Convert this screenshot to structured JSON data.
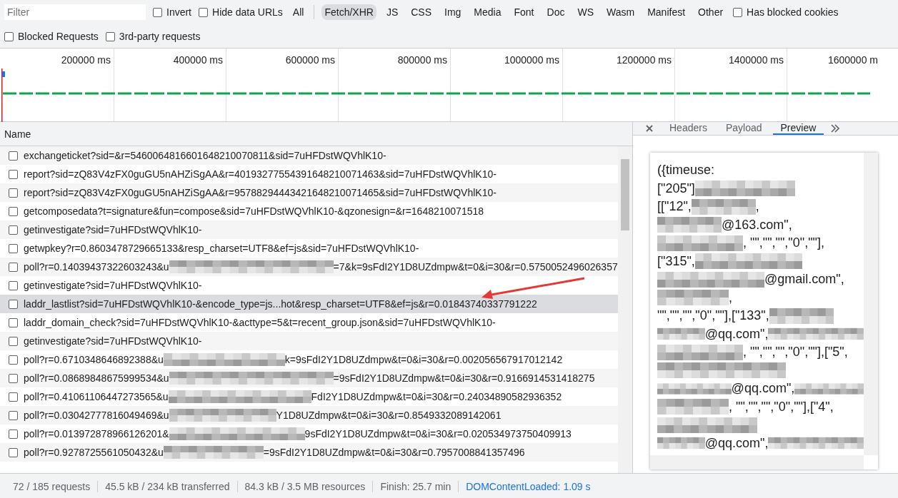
{
  "filter_bar": {
    "placeholder": "Filter",
    "checks_row1": [
      {
        "label": "Invert",
        "checked": false
      },
      {
        "label": "Hide data URLs",
        "checked": false
      }
    ],
    "types": [
      {
        "label": "All",
        "selected": false
      },
      {
        "label": "Fetch/XHR",
        "selected": true
      },
      {
        "label": "JS",
        "selected": false
      },
      {
        "label": "CSS",
        "selected": false
      },
      {
        "label": "Img",
        "selected": false
      },
      {
        "label": "Media",
        "selected": false
      },
      {
        "label": "Font",
        "selected": false
      },
      {
        "label": "Doc",
        "selected": false
      },
      {
        "label": "WS",
        "selected": false
      },
      {
        "label": "Wasm",
        "selected": false
      },
      {
        "label": "Manifest",
        "selected": false
      },
      {
        "label": "Other",
        "selected": false
      }
    ],
    "checks_row1_end": [
      {
        "label": "Has blocked cookies",
        "checked": false
      }
    ],
    "checks_row2": [
      {
        "label": "Blocked Requests",
        "checked": false
      },
      {
        "label": "3rd-party requests",
        "checked": false
      }
    ]
  },
  "timeline": {
    "ticks": [
      "200000 ms",
      "400000 ms",
      "600000 ms",
      "800000 ms",
      "1000000 ms",
      "1200000 ms",
      "1400000 ms",
      "1600000 m"
    ]
  },
  "requests": {
    "column": "Name",
    "rows": [
      {
        "selected": false,
        "parts": [
          {
            "kind": "text",
            "text": "exchangeticket?sid=&r=5460064816601648210070811&sid=7uHFDstWQVhlK10-"
          }
        ]
      },
      {
        "selected": false,
        "parts": [
          {
            "kind": "text",
            "text": "report?sid=zQ83V4zFX0guGU5nAHZiSgAA&r=40193277554391648210071463&sid=7uHFDstWQVhlK10-"
          }
        ]
      },
      {
        "selected": false,
        "parts": [
          {
            "kind": "text",
            "text": "report?sid=zQ83V4zFX0guGU5nAHZiSgAA&r=95788294443421648210071465&sid=7uHFDstWQVhlK10-"
          }
        ]
      },
      {
        "selected": false,
        "parts": [
          {
            "kind": "text",
            "text": "getcomposedata?t=signature&fun=compose&sid=7uHFDstWQVhlK10-&qzonesign=&r=1648210071518"
          }
        ]
      },
      {
        "selected": false,
        "parts": [
          {
            "kind": "text",
            "text": "getinvestigate?sid=7uHFDstWQVhlK10-"
          }
        ]
      },
      {
        "selected": false,
        "parts": [
          {
            "kind": "text",
            "text": "getwpkey?r=0.8603478729665133&resp_charset=UTF8&ef=js&sid=7uHFDstWQVhlK10-"
          }
        ]
      },
      {
        "selected": false,
        "parts": [
          {
            "kind": "text",
            "text": "poll?r=0.14039437322603243&u"
          },
          {
            "kind": "blur"
          },
          {
            "kind": "text",
            "text": "=7&k=9sFdI2Y1D8UZdmpw&t=0&i=30&r=0.5750052496026357"
          }
        ]
      },
      {
        "selected": false,
        "parts": [
          {
            "kind": "text",
            "text": "getinvestigate?sid=7uHFDstWQVhlK10-"
          }
        ]
      },
      {
        "selected": true,
        "parts": [
          {
            "kind": "text",
            "text": "laddr_lastlist?sid=7uHFDstWQVhlK10-&encode_type=js...hot&resp_charset=UTF8&ef=js&r=0.01843740337791222"
          }
        ]
      },
      {
        "selected": false,
        "parts": [
          {
            "kind": "text",
            "text": "laddr_domain_check?sid=7uHFDstWQVhlK10-&acttype=5&t=recent_group.json&sid=7uHFDstWQVhlK10-"
          }
        ]
      },
      {
        "selected": false,
        "parts": [
          {
            "kind": "text",
            "text": "getinvestigate?sid=7uHFDstWQVhlK10-"
          }
        ]
      },
      {
        "selected": false,
        "parts": [
          {
            "kind": "text",
            "text": "poll?r=0.6710348646892388&u"
          },
          {
            "kind": "blur"
          },
          {
            "kind": "text",
            "text": "k=9sFdI2Y1D8UZdmpw&t=0&i=30&r=0.002056567917012142"
          }
        ]
      },
      {
        "selected": false,
        "parts": [
          {
            "kind": "text",
            "text": "poll?r=0.08689848675999534&u"
          },
          {
            "kind": "blur"
          },
          {
            "kind": "text",
            "text": "=9sFdI2Y1D8UZdmpw&t=0&i=30&r=0.9166914531418275"
          }
        ]
      },
      {
        "selected": false,
        "parts": [
          {
            "kind": "text",
            "text": "poll?r=0.41061106447273565&u"
          },
          {
            "kind": "blur"
          },
          {
            "kind": "text",
            "text": "FdI2Y1D8UZdmpw&t=0&i=30&r=0.24034890582936352"
          }
        ]
      },
      {
        "selected": false,
        "parts": [
          {
            "kind": "text",
            "text": "poll?r=0.03042777816049469&u"
          },
          {
            "kind": "blur"
          },
          {
            "kind": "text",
            "text": "Y1D8UZdmpw&t=0&i=30&r=0.8549332089142061"
          }
        ]
      },
      {
        "selected": false,
        "parts": [
          {
            "kind": "text",
            "text": "poll?r=0.013972878966126201&"
          },
          {
            "kind": "blur"
          },
          {
            "kind": "text",
            "text": "9sFdI2Y1D8UZdmpw&t=0&i=30&r=0.020534973750409913"
          }
        ]
      },
      {
        "selected": false,
        "parts": [
          {
            "kind": "text",
            "text": "poll?r=0.9278725561050432&u"
          },
          {
            "kind": "blur"
          },
          {
            "kind": "text",
            "text": "=9sFdI2Y1D8UZdmpw&t=0&i=30&r=0.7957008841357496"
          }
        ]
      }
    ]
  },
  "details": {
    "tabs": [
      {
        "label": "Headers",
        "selected": false
      },
      {
        "label": "Payload",
        "selected": false
      },
      {
        "label": "Preview",
        "selected": true
      }
    ],
    "preview_lines": [
      [
        {
          "kind": "text",
          "text": "({timeuse:"
        }
      ],
      [
        {
          "kind": "text",
          "text": "[\"205\"]"
        },
        {
          "kind": "blur"
        }
      ],
      [
        {
          "kind": "text",
          "text": "[[\"12\","
        },
        {
          "kind": "blur"
        },
        {
          "kind": "text",
          "text": ","
        }
      ],
      [
        {
          "kind": "blur"
        },
        {
          "kind": "text",
          "text": "@163.com\","
        }
      ],
      [
        {
          "kind": "blur"
        },
        {
          "kind": "text",
          "text": ", \"\",\"\",\"\",\"0\",\"\"],"
        }
      ],
      [
        {
          "kind": "text",
          "text": "[\"315\","
        },
        {
          "kind": "blur"
        }
      ],
      [
        {
          "kind": "blur"
        },
        {
          "kind": "text",
          "text": "@gmail.com\","
        }
      ],
      [
        {
          "kind": "blur"
        },
        {
          "kind": "text",
          "text": ","
        }
      ],
      [
        {
          "kind": "text",
          "text": "\"\",\"\",\"\",\"0\",\"\"],[\"133\","
        },
        {
          "kind": "blur"
        }
      ],
      [
        {
          "kind": "blur"
        },
        {
          "kind": "text",
          "text": "@qq.com\","
        },
        {
          "kind": "blur"
        }
      ],
      [
        {
          "kind": "blur"
        },
        {
          "kind": "text",
          "text": ", \"\",\"\",\"\",\"0\",\"\"],[\"5\","
        }
      ],
      [
        {
          "kind": "blur"
        }
      ],
      [
        {
          "kind": "blur"
        },
        {
          "kind": "text",
          "text": "@qq.com\","
        },
        {
          "kind": "blur"
        }
      ],
      [
        {
          "kind": "blur"
        },
        {
          "kind": "text",
          "text": ", \"\",\"\",\"\",\"0\",\"\"],[\"4\","
        }
      ],
      [
        {
          "kind": "blur"
        }
      ],
      [
        {
          "kind": "blur"
        },
        {
          "kind": "text",
          "text": "@qq.com\","
        },
        {
          "kind": "blur"
        }
      ]
    ]
  },
  "status_bar": [
    {
      "kind": "plain",
      "text": "72 / 185 requests"
    },
    {
      "kind": "plain",
      "text": "45.5 kB / 234 kB transferred"
    },
    {
      "kind": "plain",
      "text": "84.3 kB / 3.5 MB resources"
    },
    {
      "kind": "plain",
      "text": "Finish: 25.7 min"
    },
    {
      "kind": "link",
      "text": "DOMContentLoaded: 1.09 s"
    }
  ]
}
